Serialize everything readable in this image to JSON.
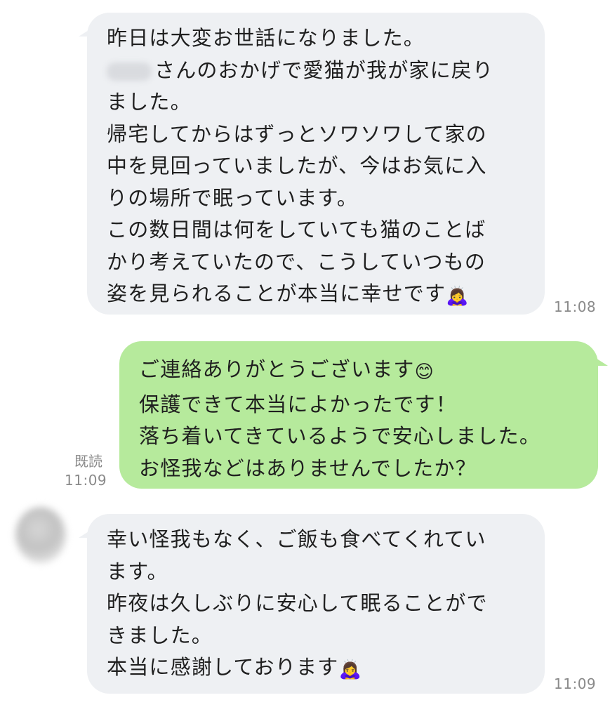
{
  "messages": [
    {
      "direction": "incoming",
      "redacted_prefix_on_line": 2,
      "lines": [
        "昨日は大変お世話になりました。",
        "さんのおかげで愛猫が我が家に戻り",
        "ました。",
        "帰宅してからはずっとソワソワして家の",
        "中を見回っていましたが、今はお気に入",
        "りの場所で眠っています。",
        "この数日間は何をしていても猫のことば",
        "かり考えていたので、こうしていつもの",
        "姿を見られることが本当に幸せです"
      ],
      "trailing_emoji": "🙇‍♀️",
      "time": "11:08"
    },
    {
      "direction": "outgoing",
      "lines": [
        "ご連絡ありがとうございます",
        "保護できて本当によかったです！",
        "落ち着いてきているようで安心しました。",
        "お怪我などはありませんでしたか？"
      ],
      "first_line_emoji": "😊",
      "read_label": "既読",
      "time": "11:09"
    },
    {
      "direction": "incoming",
      "lines": [
        "幸い怪我もなく、ご飯も食べてくれてい",
        "ます。",
        "昨夜は久しぶりに安心して眠ることがで",
        "きました。",
        "本当に感謝しております"
      ],
      "trailing_emoji": "🙇‍♀️",
      "time": "11:09"
    }
  ],
  "colors": {
    "incoming_bubble": "#eef0f3",
    "outgoing_bubble": "#b6ea9c",
    "text": "#1f1f1f",
    "meta_text": "#8a8a8a",
    "background": "#ffffff"
  },
  "icons": {
    "avatar": "blurred-avatar",
    "bow_emoji": "bowing-woman-emoji",
    "smile_emoji": "smiling-face-emoji"
  }
}
